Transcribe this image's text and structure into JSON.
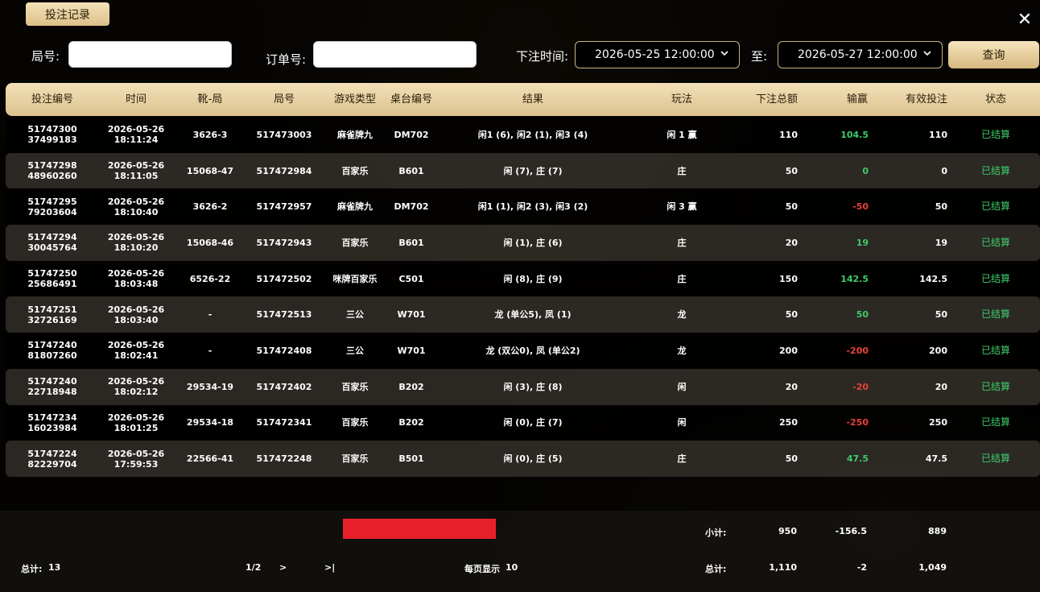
{
  "dialog": {
    "title": "投注记录",
    "close_glyph": "✕"
  },
  "filters": {
    "round_label": "局号:",
    "round_value": "",
    "order_label": "订单号:",
    "order_value": "",
    "time_label": "下注时间:",
    "start_time": "2026-05-25 12:00:00",
    "to_label": "至:",
    "end_time": "2026-05-27 12:00:00",
    "query_label": "查询"
  },
  "table": {
    "headers": [
      "投注编号",
      "时间",
      "靴-局",
      "局号",
      "游戏类型",
      "桌台编号",
      "结果",
      "玩法",
      "下注总额",
      "输赢",
      "有效投注",
      "状态"
    ],
    "rows": [
      {
        "id1": "51747300",
        "id2": "37499183",
        "date": "2026-05-26",
        "time": "18:11:24",
        "shoe": "3626-3",
        "round": "517473003",
        "game": "麻雀牌九",
        "table": "DM702",
        "result": "闲1 (6), 闲2 (1), 闲3 (4)",
        "play": "闲 1 赢",
        "amount": "110",
        "winloss": "104.5",
        "wl_type": "win",
        "valid": "110",
        "status": "已结算"
      },
      {
        "id1": "51747298",
        "id2": "48960260",
        "date": "2026-05-26",
        "time": "18:11:05",
        "shoe": "15068-47",
        "round": "517472984",
        "game": "百家乐",
        "table": "B601",
        "result": "闲 (7), 庄 (7)",
        "play": "庄",
        "amount": "50",
        "winloss": "0",
        "wl_type": "win",
        "valid": "0",
        "status": "已结算"
      },
      {
        "id1": "51747295",
        "id2": "79203604",
        "date": "2026-05-26",
        "time": "18:10:40",
        "shoe": "3626-2",
        "round": "517472957",
        "game": "麻雀牌九",
        "table": "DM702",
        "result": "闲1 (1), 闲2 (3), 闲3 (2)",
        "play": "闲 3 赢",
        "amount": "50",
        "winloss": "-50",
        "wl_type": "lose",
        "valid": "50",
        "status": "已结算"
      },
      {
        "id1": "51747294",
        "id2": "30045764",
        "date": "2026-05-26",
        "time": "18:10:20",
        "shoe": "15068-46",
        "round": "517472943",
        "game": "百家乐",
        "table": "B601",
        "result": "闲 (1), 庄 (6)",
        "play": "庄",
        "amount": "20",
        "winloss": "19",
        "wl_type": "win",
        "valid": "19",
        "status": "已结算"
      },
      {
        "id1": "51747250",
        "id2": "25686491",
        "date": "2026-05-26",
        "time": "18:03:48",
        "shoe": "6526-22",
        "round": "517472502",
        "game": "咪牌百家乐",
        "table": "C501",
        "result": "闲 (8), 庄 (9)",
        "play": "庄",
        "amount": "150",
        "winloss": "142.5",
        "wl_type": "win",
        "valid": "142.5",
        "status": "已结算"
      },
      {
        "id1": "51747251",
        "id2": "32726169",
        "date": "2026-05-26",
        "time": "18:03:40",
        "shoe": "-",
        "round": "517472513",
        "game": "三公",
        "table": "W701",
        "result": "龙 (单公5), 凤 (1)",
        "play": "龙",
        "amount": "50",
        "winloss": "50",
        "wl_type": "win",
        "valid": "50",
        "status": "已结算"
      },
      {
        "id1": "51747240",
        "id2": "81807260",
        "date": "2026-05-26",
        "time": "18:02:41",
        "shoe": "-",
        "round": "517472408",
        "game": "三公",
        "table": "W701",
        "result": "龙 (双公0), 凤 (单公2)",
        "play": "龙",
        "amount": "200",
        "winloss": "-200",
        "wl_type": "lose",
        "valid": "200",
        "status": "已结算"
      },
      {
        "id1": "51747240",
        "id2": "22718948",
        "date": "2026-05-26",
        "time": "18:02:12",
        "shoe": "29534-19",
        "round": "517472402",
        "game": "百家乐",
        "table": "B202",
        "result": "闲 (3), 庄 (8)",
        "play": "闲",
        "amount": "20",
        "winloss": "-20",
        "wl_type": "lose",
        "valid": "20",
        "status": "已结算"
      },
      {
        "id1": "51747234",
        "id2": "16023984",
        "date": "2026-05-26",
        "time": "18:01:25",
        "shoe": "29534-18",
        "round": "517472341",
        "game": "百家乐",
        "table": "B202",
        "result": "闲 (0), 庄 (7)",
        "play": "闲",
        "amount": "250",
        "winloss": "-250",
        "wl_type": "lose",
        "valid": "250",
        "status": "已结算"
      },
      {
        "id1": "51747224",
        "id2": "82229704",
        "date": "2026-05-26",
        "time": "17:59:53",
        "shoe": "22566-41",
        "round": "517472248",
        "game": "百家乐",
        "table": "B501",
        "result": "闲 (0), 庄 (5)",
        "play": "庄",
        "amount": "50",
        "winloss": "47.5",
        "wl_type": "win",
        "valid": "47.5",
        "status": "已结算"
      }
    ]
  },
  "subtotal": {
    "label": "小计:",
    "amount": "950",
    "winloss": "-156.5",
    "valid": "889"
  },
  "total": {
    "label": "总计:",
    "amount": "1,110",
    "winloss": "-2",
    "valid": "1,049"
  },
  "pagination": {
    "total_label": "总计:",
    "total_count": "13",
    "page": "1/2",
    "next": ">",
    "last": ">|",
    "per_page_label": "每页显示",
    "per_page": "10"
  },
  "colors": {
    "accent": "#dcc38f",
    "win": "#3dcc6a",
    "lose": "#e8403a",
    "redaction": "#e8202a"
  }
}
